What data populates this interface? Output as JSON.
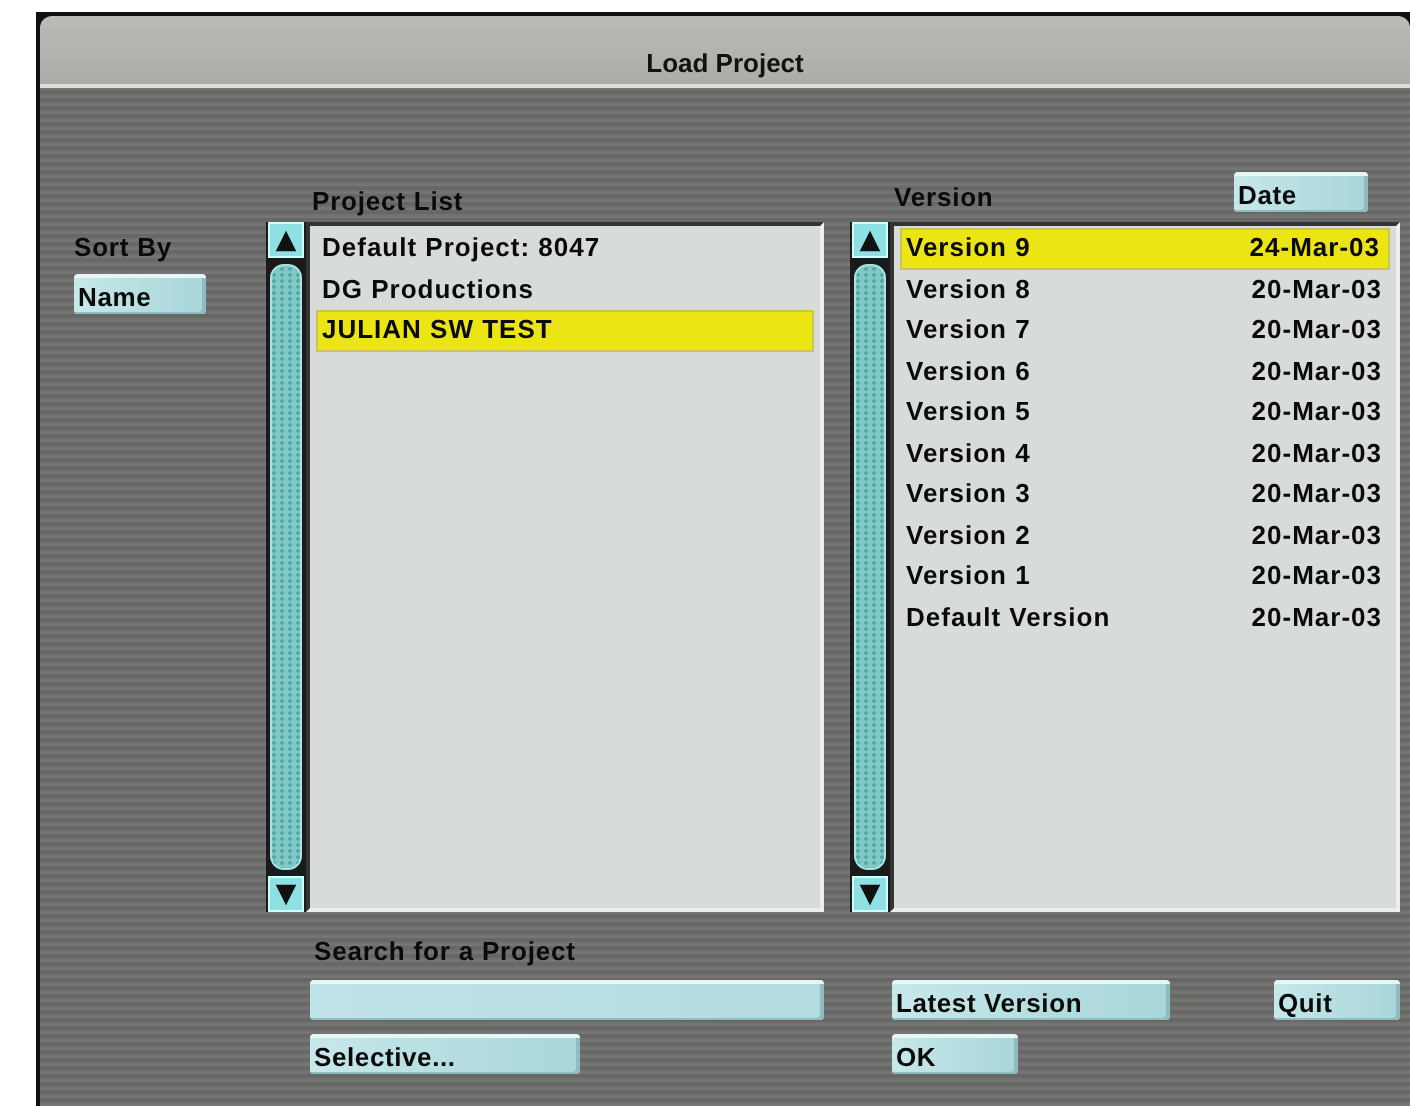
{
  "window": {
    "title": "Load Project"
  },
  "sort": {
    "label": "Sort By",
    "button": "Name"
  },
  "project_list": {
    "label": "Project List",
    "items": [
      {
        "name": "Default Project: 8047",
        "selected": false
      },
      {
        "name": "DG Productions",
        "selected": false
      },
      {
        "name": "JULIAN SW TEST",
        "selected": true
      }
    ]
  },
  "version_list": {
    "label": "Version",
    "sort_button": "Date",
    "items": [
      {
        "name": "Version 9",
        "date": "24-Mar-03",
        "selected": true
      },
      {
        "name": "Version 8",
        "date": "20-Mar-03",
        "selected": false
      },
      {
        "name": "Version 7",
        "date": "20-Mar-03",
        "selected": false
      },
      {
        "name": "Version 6",
        "date": "20-Mar-03",
        "selected": false
      },
      {
        "name": "Version 5",
        "date": "20-Mar-03",
        "selected": false
      },
      {
        "name": "Version 4",
        "date": "20-Mar-03",
        "selected": false
      },
      {
        "name": "Version 3",
        "date": "20-Mar-03",
        "selected": false
      },
      {
        "name": "Version 2",
        "date": "20-Mar-03",
        "selected": false
      },
      {
        "name": "Version 1",
        "date": "20-Mar-03",
        "selected": false
      },
      {
        "name": "Default Version",
        "date": "20-Mar-03",
        "selected": false
      }
    ]
  },
  "search": {
    "label": "Search for a Project"
  },
  "buttons": [
    {
      "kind": "latest",
      "label": "Latest Version"
    },
    {
      "kind": "quit",
      "label": "Quit"
    },
    {
      "kind": "selective",
      "label": "Selective..."
    },
    {
      "kind": "ok",
      "label": "OK"
    }
  ]
}
